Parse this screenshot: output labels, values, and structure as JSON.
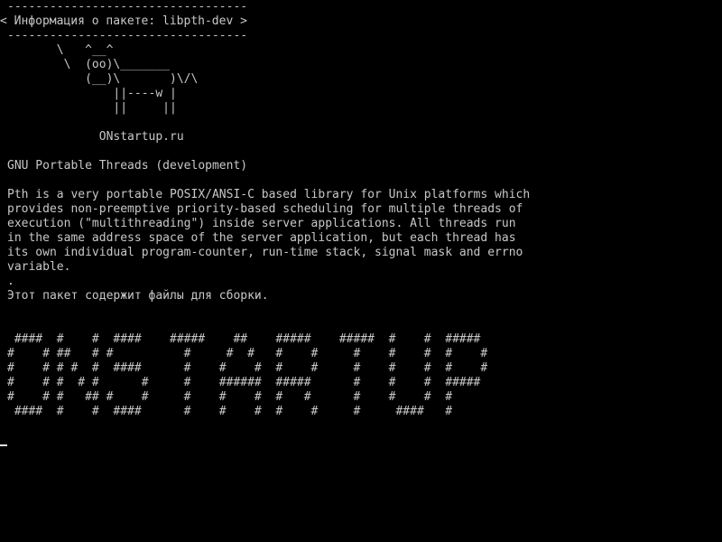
{
  "cowsay": {
    "bubble_top": "----------------------------------",
    "bubble_text": "< Информация о пакете: libpth-dev >",
    "bubble_bottom": "----------------------------------",
    "cow_line_1": "       \\   ^__^",
    "cow_line_2": "        \\  (oo)\\_______",
    "cow_line_3": "           (__)\\       )\\/\\",
    "cow_line_4": "               ||----w |",
    "cow_line_5": "               ||     ||",
    "site_label": "             ONstartup.ru"
  },
  "package": {
    "summary": "GNU Portable Threads (development)",
    "description_lines": [
      "Pth is a very portable POSIX/ANSI-C based library for Unix platforms which",
      "provides non-preemptive priority-based scheduling for multiple threads of",
      "execution (\"multithreading\") inside server applications. All threads run",
      "in the same address space of the server application, but each thread has",
      "its own individual program-counter, run-time stack, signal mask and errno",
      "variable.",
      "."
    ],
    "note": "Этот пакет содержит файлы для сборки."
  },
  "banner": {
    "lines": [
      " ####  #    #  ####    #####    ##    #####    #####  #    #  #####",
      "#    # ##   # #          #     #  #   #    #     #    #    #  #    #",
      "#    # # #  #  ####      #    #    #  #    #     #    #    #  #    #",
      "#    # #  # #      #     #    ######  #####      #    #    #  #####",
      "#    # #   ## #    #     #    #    #  #   #      #    #    #  #",
      " ####  #    #  ####      #    #    #  #    #     #     ####   #"
    ]
  },
  "colors": {
    "background": "#000000",
    "foreground": "#c8c8c8"
  }
}
